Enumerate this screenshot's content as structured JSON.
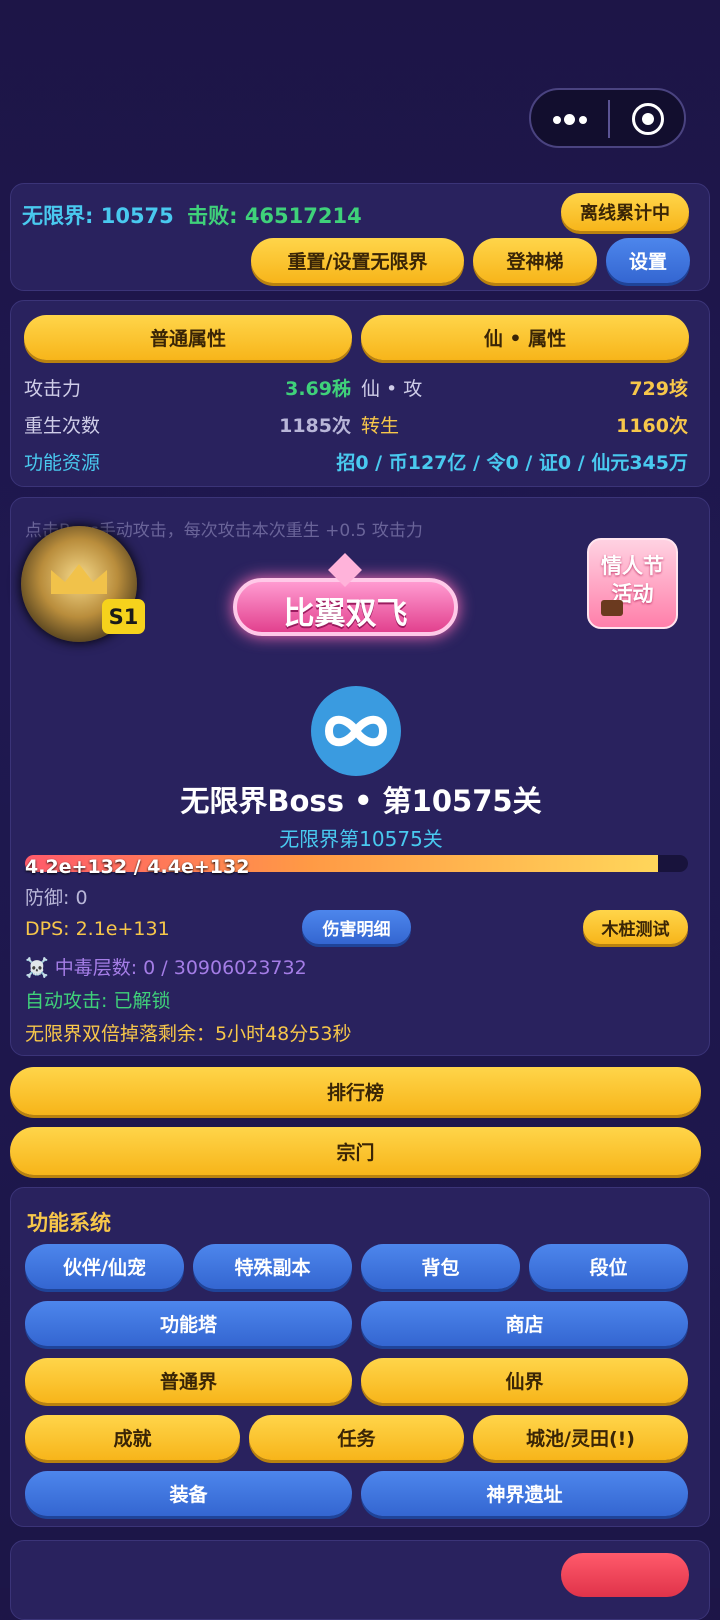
{
  "capsule": {
    "more_icon": "more-dots-icon",
    "close_icon": "target-circle-icon"
  },
  "top": {
    "realm_label": "无限界:",
    "realm_value": "10575",
    "kill_label": "击败:",
    "kill_value": "46517214",
    "offline_badge": "离线累计中",
    "reset_btn": "重置/设置无限界",
    "ladder_btn": "登神梯",
    "settings_btn": "设置"
  },
  "attrs": {
    "tab_normal": "普通属性",
    "tab_immortal": "仙 • 属性",
    "attack_label": "攻击力",
    "attack_value": "3.69秭",
    "imm_attack_label": "仙 • 攻",
    "imm_attack_value": "729垓",
    "rebirth_label": "重生次数",
    "rebirth_value": "1185次",
    "reincarnate_label": "转生",
    "reincarnate_value": "1160次",
    "resource_label": "功能资源",
    "resource_value": "招0 / 币127亿 / 令0 / 证0 / 仙元345万"
  },
  "boss": {
    "hint": "点击Boss手动攻击，每次攻击本次重生 +0.5 攻击力",
    "season_badge": "S1",
    "event_banner": "比翼双飞",
    "valentine_label_1": "情人节",
    "valentine_label_2": "活动",
    "boss_icon": "infinity-icon",
    "title": "无限界Boss • 第10575关",
    "subtitle": "无限界第10575关",
    "hp_text": "4.2e+132 / 4.4e+132",
    "hp_fraction": 0.9545,
    "defense": "防御: 0",
    "dps": "DPS: 2.1e+131",
    "damage_detail_btn": "伤害明细",
    "dummy_test_btn": "木桩测试",
    "poison_icon": "☠️",
    "poison_text": "中毒层数: 0 / 30906023732",
    "auto_attack": "自动攻击: 已解锁",
    "double_drop": "无限界双倍掉落剩余：5小时48分53秒"
  },
  "main_buttons": {
    "ranking": "排行榜",
    "sect": "宗门"
  },
  "functions": {
    "title": "功能系统",
    "row1": [
      "伙伴/仙宠",
      "特殊副本",
      "背包",
      "段位"
    ],
    "row2": [
      "功能塔",
      "商店"
    ],
    "row3": [
      "普通界",
      "仙界"
    ],
    "row4": [
      "成就",
      "任务",
      "城池/灵田(!)"
    ],
    "row5": [
      "装备",
      "神界遗址"
    ]
  },
  "colors": {
    "yellow": "#f7b51a",
    "blue": "#3466d1",
    "green": "#3fd17a",
    "cyan": "#49c9ef",
    "gold": "#f7c74a",
    "purple": "#a47de6"
  }
}
